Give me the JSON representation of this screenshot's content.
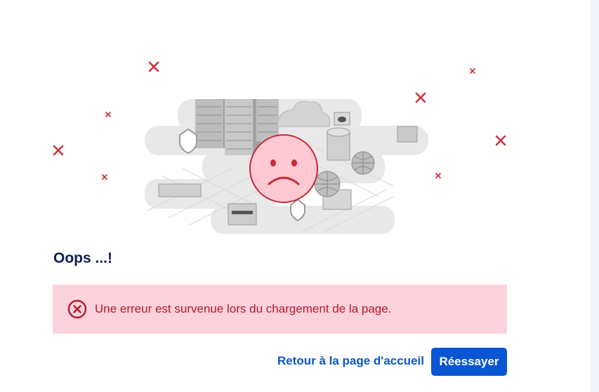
{
  "page": {
    "title": "Oops ...!",
    "error_message": "Une erreur est survenue lors du chargement de la page.",
    "home_link_label": "Retour à la page d'accueil",
    "retry_button_label": "Réessayer"
  },
  "illustration": {
    "subject": "isometric data center city with sad face",
    "icons": [
      "x-mark-icon",
      "sad-face-icon"
    ]
  },
  "colors": {
    "title": "#0b1f52",
    "alert_background": "#fdd2dc",
    "alert_text": "#b3192c",
    "link": "#0a56c6",
    "button": "#0a56d2",
    "x_marks": "#d0313b"
  }
}
